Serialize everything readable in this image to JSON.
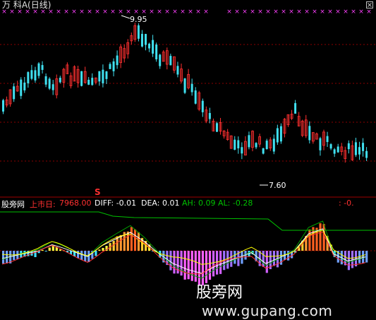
{
  "window": {
    "title": "万  科A(日线)"
  },
  "markers": {
    "high": "9.95",
    "low": "7.60",
    "signal": "S"
  },
  "indicator": {
    "source": "股旁网",
    "listing_label": "上市日:",
    "listing_value": "7968.00",
    "diff": "DIFF: -0.01",
    "dea": "DEA: 0.01",
    "ah": "AH: 0.09",
    "al": "AL: -0.28",
    "right_value": ": -0."
  },
  "watermark": {
    "cn": "股旁网",
    "url": "www.gupang.com"
  },
  "colors": {
    "bg": "#000000",
    "up": "#ff3030",
    "down": "#40e0f0",
    "grid": "#8b0000",
    "cross": "#ff40ff",
    "white": "#ffffff",
    "yellow": "#ffff00",
    "green": "#00c000"
  }
}
